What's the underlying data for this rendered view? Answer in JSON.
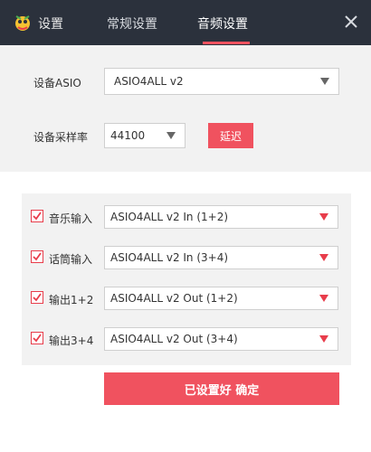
{
  "header": {
    "app_title": "设置",
    "tabs": [
      {
        "label": "常规设置",
        "active": false
      },
      {
        "label": "音频设置",
        "active": true
      }
    ]
  },
  "asio": {
    "device_label": "设备ASIO",
    "device_value": "ASIO4ALL v2",
    "sample_rate_label": "设备采样率",
    "sample_rate_value": "44100",
    "delay_button": "延迟"
  },
  "routing": [
    {
      "label": "音乐输入",
      "checked": true,
      "value": "ASIO4ALL v2 In (1+2)"
    },
    {
      "label": "话筒输入",
      "checked": true,
      "value": "ASIO4ALL v2 In (3+4)"
    },
    {
      "label": "输出1+2",
      "checked": true,
      "value": "ASIO4ALL v2 Out (1+2)"
    },
    {
      "label": "输出3+4",
      "checked": true,
      "value": "ASIO4ALL v2 Out (3+4)"
    }
  ],
  "confirm_button": "已设置好 确定",
  "colors": {
    "titlebar": "#2b313c",
    "accent": "#f0525f",
    "panel": "#f2f2f2"
  }
}
